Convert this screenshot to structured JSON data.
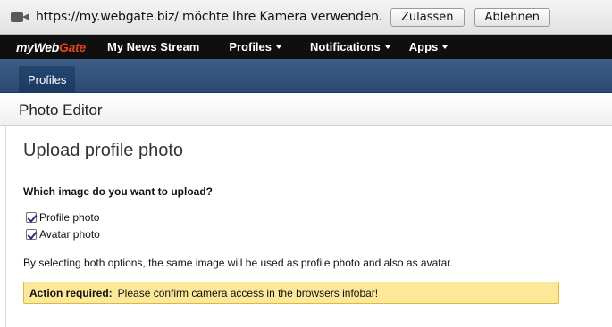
{
  "infobar": {
    "message": "https://my.webgate.biz/ möchte Ihre Kamera verwenden.",
    "allow_label": "Zulassen",
    "deny_label": "Ablehnen"
  },
  "topnav": {
    "logo_part1": "my",
    "logo_part2": "Web",
    "logo_part3": "Gate",
    "items": [
      {
        "label": "My News Stream",
        "has_dropdown": false
      },
      {
        "label": "Profiles",
        "has_dropdown": true
      },
      {
        "label": "Notifications",
        "has_dropdown": true
      },
      {
        "label": "Apps",
        "has_dropdown": true
      }
    ]
  },
  "subnav": {
    "active_tab": "Profiles"
  },
  "page": {
    "title": "Photo Editor",
    "section_title": "Upload profile photo",
    "question": "Which image do you want to upload?",
    "options": [
      {
        "label": "Profile photo",
        "checked": true
      },
      {
        "label": "Avatar photo",
        "checked": true
      }
    ],
    "note": "By selecting both options, the same image will be used as profile photo and also as avatar.",
    "alert_label": "Action required:",
    "alert_text": "Please confirm camera access in the browsers infobar!"
  },
  "colors": {
    "nav_bg": "#0f0f0f",
    "subbar_bg": "#2f5079",
    "alert_bg": "#fde89a",
    "logo_accent": "#e0441c"
  },
  "icons": {
    "infobar_icon": "camera-icon"
  }
}
